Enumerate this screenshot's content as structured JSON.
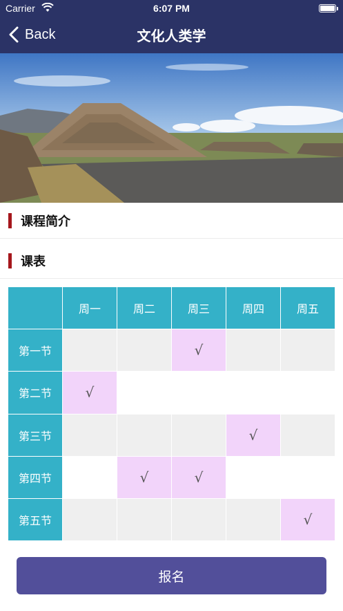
{
  "status_bar": {
    "carrier": "Carrier",
    "time": "6:07 PM"
  },
  "nav": {
    "back_label": "Back",
    "title": "文化人类学"
  },
  "sections": {
    "intro": "课程简介",
    "schedule": "课表"
  },
  "timetable": {
    "days": [
      "周一",
      "周二",
      "周三",
      "周四",
      "周五"
    ],
    "rows": [
      {
        "period": "第一节",
        "cells": [
          "",
          "",
          "√",
          "",
          ""
        ]
      },
      {
        "period": "第二节",
        "cells": [
          "√",
          "",
          "",
          "",
          ""
        ]
      },
      {
        "period": "第三节",
        "cells": [
          "",
          "",
          "",
          "√",
          ""
        ]
      },
      {
        "period": "第四节",
        "cells": [
          "",
          "√",
          "√",
          "",
          ""
        ]
      },
      {
        "period": "第五节",
        "cells": [
          "",
          "",
          "",
          "",
          "√"
        ]
      }
    ]
  },
  "enroll_button": {
    "label": "报名"
  },
  "colors": {
    "nav": "#2b3366",
    "header_cell": "#34b1c8",
    "selected_cell": "#f2d4fa",
    "button": "#524f9a",
    "section_marker": "#a5171c"
  }
}
